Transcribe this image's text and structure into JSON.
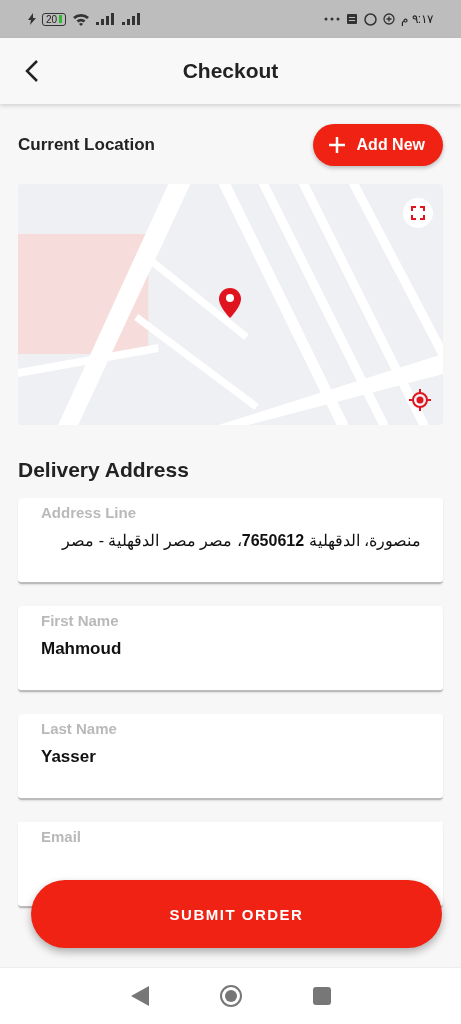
{
  "status_bar": {
    "battery": "20",
    "time": "٩:١٧ م"
  },
  "header": {
    "title": "Checkout"
  },
  "location": {
    "title": "Current Location",
    "add_button": "Add New"
  },
  "delivery": {
    "title": "Delivery Address",
    "fields": [
      {
        "label": "Address Line",
        "value": "منصورة، الدقهلية **7650612**، مصر مصر الدقهلية - مصر",
        "kind": "address"
      },
      {
        "label": "First Name",
        "value": "Mahmoud",
        "kind": "text"
      },
      {
        "label": "Last Name",
        "value": "Yasser",
        "kind": "text"
      },
      {
        "label": "Email"
      }
    ]
  },
  "submit_button": "SUBMIT ORDER"
}
